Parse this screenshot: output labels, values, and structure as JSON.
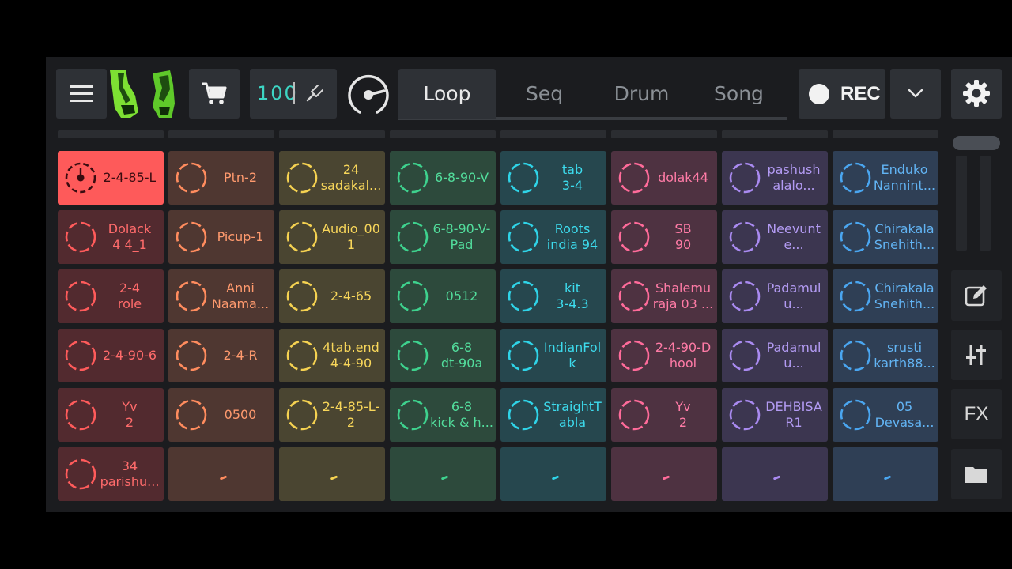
{
  "toolbar": {
    "menu_icon": "hamburger-menu-icon",
    "logo_icon": "green-shoes-logo",
    "cart_icon": "shopping-cart-icon",
    "bpm_value": "100",
    "tap_icon": "tuning-fork-icon",
    "metronome_icon": "metronome-knob-icon",
    "tabs": [
      {
        "label": "Loop",
        "active": true
      },
      {
        "label": "Seq",
        "active": false
      },
      {
        "label": "Drum",
        "active": false
      },
      {
        "label": "Song",
        "active": false
      }
    ],
    "rec_label": "REC",
    "dropdown_icon": "chevron-down-icon",
    "settings_icon": "gear-icon"
  },
  "colors": {
    "accent": "#3dd6c4",
    "columns": [
      {
        "ring": "#ff5b5b",
        "text": "#ff6b6b",
        "bg": "#522a2f"
      },
      {
        "ring": "#ff8c5e",
        "text": "#ff9a6e",
        "bg": "#4f3731"
      },
      {
        "ring": "#f5d251",
        "text": "#f8d65a",
        "bg": "#4a4531"
      },
      {
        "ring": "#3ed28e",
        "text": "#52dd9c",
        "bg": "#2d4a3c"
      },
      {
        "ring": "#2fd4e8",
        "text": "#3ddcee",
        "bg": "#26474e"
      },
      {
        "ring": "#ff6b9a",
        "text": "#ff7ba6",
        "bg": "#4e3241"
      },
      {
        "ring": "#a98af0",
        "text": "#b39bf3",
        "bg": "#3c3650"
      },
      {
        "ring": "#4aa6f0",
        "text": "#62b4f4",
        "bg": "#2f3f55"
      }
    ],
    "active_pad_bg": "#fe5a5a",
    "active_pad_text": "#3a0c10"
  },
  "grid": {
    "columns": [
      {
        "pads": [
          {
            "lines": [
              "2-4-85-L"
            ],
            "active": true
          },
          {
            "lines": [
              "Dolack",
              "4 4_1"
            ]
          },
          {
            "lines": [
              "2-4",
              "role"
            ]
          },
          {
            "lines": [
              "2-4-90-6"
            ]
          },
          {
            "lines": [
              "Yv",
              "2"
            ]
          },
          {
            "lines": [
              "34",
              "parishu..."
            ]
          }
        ]
      },
      {
        "pads": [
          {
            "lines": [
              "Ptn-2"
            ]
          },
          {
            "lines": [
              "Picup-1"
            ]
          },
          {
            "lines": [
              "Anni",
              "Naama..."
            ]
          },
          {
            "lines": [
              "2-4-R"
            ]
          },
          {
            "lines": [
              "0500"
            ]
          },
          {
            "empty": true
          }
        ]
      },
      {
        "pads": [
          {
            "lines": [
              "24",
              "sadakal..."
            ]
          },
          {
            "lines": [
              "Audio_00",
              "1"
            ]
          },
          {
            "lines": [
              "2-4-65"
            ]
          },
          {
            "lines": [
              "4tab.end",
              "4-4-90"
            ]
          },
          {
            "lines": [
              "2-4-85-L-",
              "2"
            ]
          },
          {
            "empty": true
          }
        ]
      },
      {
        "pads": [
          {
            "lines": [
              "6-8-90-V"
            ]
          },
          {
            "lines": [
              "6-8-90-V-",
              "Pad"
            ]
          },
          {
            "lines": [
              "0512"
            ]
          },
          {
            "lines": [
              "6-8",
              "dt-90a"
            ]
          },
          {
            "lines": [
              "6-8",
              "kick & h..."
            ]
          },
          {
            "empty": true
          }
        ]
      },
      {
        "pads": [
          {
            "lines": [
              "tab",
              "3-4"
            ]
          },
          {
            "lines": [
              "Roots",
              "india 94"
            ]
          },
          {
            "lines": [
              "kit",
              "3-4.3"
            ]
          },
          {
            "lines": [
              "IndianFol",
              "k"
            ]
          },
          {
            "lines": [
              "StraightT",
              "abla"
            ]
          },
          {
            "empty": true
          }
        ]
      },
      {
        "pads": [
          {
            "lines": [
              "dolak44"
            ]
          },
          {
            "lines": [
              "SB",
              "90"
            ]
          },
          {
            "lines": [
              "Shalemu",
              "raja 03 ..."
            ]
          },
          {
            "lines": [
              "2-4-90-D",
              "hool"
            ]
          },
          {
            "lines": [
              "Yv",
              "2"
            ]
          },
          {
            "empty": true
          }
        ]
      },
      {
        "pads": [
          {
            "lines": [
              "pashush",
              "alalo..."
            ]
          },
          {
            "lines": [
              "Neevunt",
              "e..."
            ]
          },
          {
            "lines": [
              "Padamul",
              "u..."
            ]
          },
          {
            "lines": [
              "Padamul",
              "u..."
            ]
          },
          {
            "lines": [
              "DEHBISA",
              "R1"
            ]
          },
          {
            "empty": true
          }
        ]
      },
      {
        "pads": [
          {
            "lines": [
              "Enduko",
              "Nannint..."
            ]
          },
          {
            "lines": [
              "Chirakala",
              "Snehith..."
            ]
          },
          {
            "lines": [
              "Chirakala",
              "Snehith..."
            ]
          },
          {
            "lines": [
              "srusti",
              "karth88..."
            ]
          },
          {
            "lines": [
              "05",
              "Devasa..."
            ]
          },
          {
            "empty": true
          }
        ]
      }
    ]
  },
  "sidebar": {
    "edit_icon": "edit-icon",
    "mixer_icon": "mixer-sliders-icon",
    "fx_label": "FX",
    "folder_icon": "folder-icon"
  }
}
